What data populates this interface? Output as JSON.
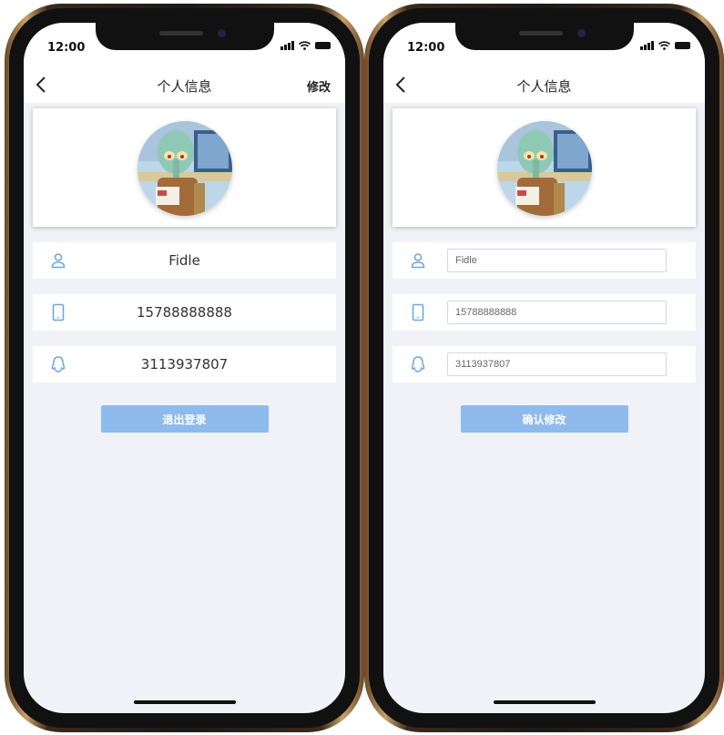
{
  "status": {
    "time": "12:00"
  },
  "left": {
    "title": "个人信息",
    "edit_label": "修改",
    "name": "Fidle",
    "phone": "15788888888",
    "qq": "3113937807",
    "logout_label": "退出登录"
  },
  "right": {
    "title": "个人信息",
    "name_value": "Fidle",
    "phone_value": "15788888888",
    "qq_value": "3113937807",
    "confirm_label": "确认修改"
  },
  "colors": {
    "accent": "#8fbaec",
    "icon": "#6fa8dc",
    "background": "#f0f2f7"
  },
  "icons": [
    "back-arrow-icon",
    "user-icon",
    "phone-icon",
    "qq-icon",
    "signal-icon",
    "wifi-icon",
    "battery-icon"
  ]
}
